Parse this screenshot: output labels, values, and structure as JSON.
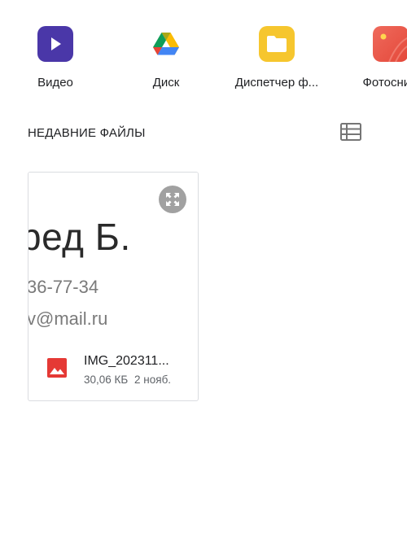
{
  "apps": [
    {
      "label": "Видео",
      "icon": "play-icon",
      "color": "#4a37a8"
    },
    {
      "label": "Диск",
      "icon": "google-drive-icon",
      "color": "#ffffff"
    },
    {
      "label": "Диспетчер ф...",
      "icon": "folder-icon",
      "color": "#f6c62e"
    },
    {
      "label": "Фотосним",
      "icon": "photos-icon",
      "color": "#e4483a"
    }
  ],
  "recent": {
    "title": "НЕДАВНИЕ ФАЙЛЫ",
    "view_toggle_icon": "list-view-icon"
  },
  "files": [
    {
      "preview_lines": [
        "ред Б.",
        "36-77-34",
        "v@mail.ru"
      ],
      "name": "IMG_202311...",
      "size": "30,06 КБ",
      "date": "2 нояб.",
      "type_icon": "image-icon",
      "type_color": "#e53935"
    }
  ]
}
